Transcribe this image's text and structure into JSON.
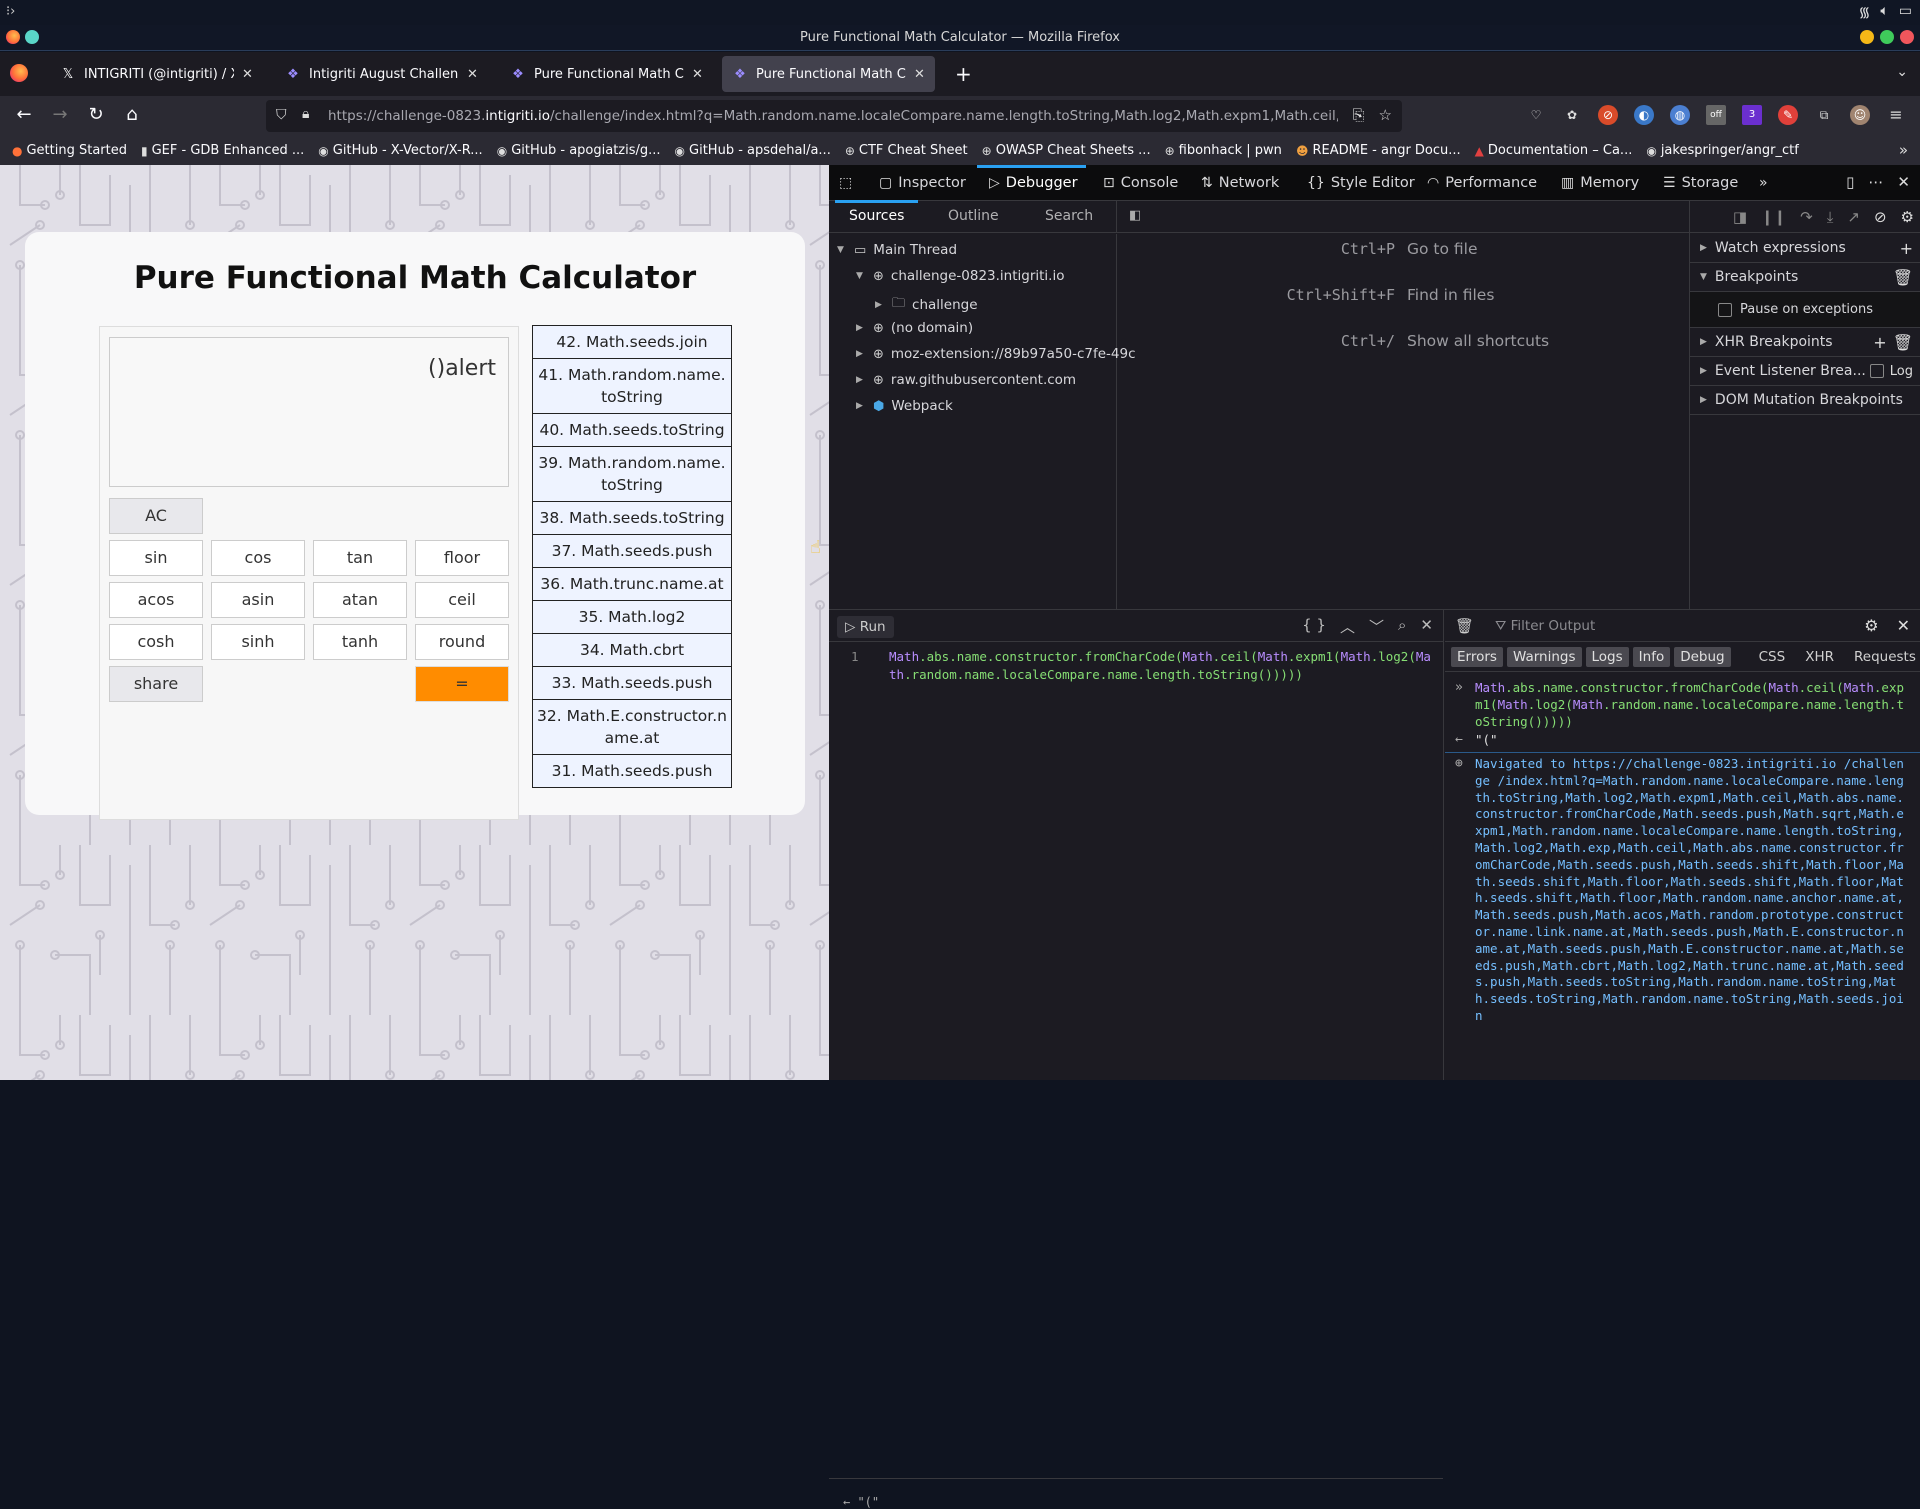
{
  "system": {
    "launcher_icon": "launcher-icon",
    "tray": [
      "wifi-icon",
      "volume-icon",
      "battery-icon"
    ]
  },
  "window": {
    "title": "Pure Functional Math Calculator — Mozilla Firefox"
  },
  "tabs": [
    {
      "label": "INTIGRITI (@intigriti) / X",
      "icon": "x-logo-icon",
      "glyph": "𝕏"
    },
    {
      "label": "Intigriti August Challenge",
      "icon": "intigriti-icon",
      "glyph": "❖"
    },
    {
      "label": "Pure Functional Math Calculator",
      "icon": "intigriti-icon",
      "glyph": "❖"
    },
    {
      "label": "Pure Functional Math Calculator",
      "icon": "intigriti-icon",
      "glyph": "❖",
      "active": true
    }
  ],
  "nav": {
    "url_prefix": "https://challenge-0823.",
    "url_domain": "intigriti.io",
    "url_rest": "/challenge/index.html?q=Math.random.name.localeCompare.name.length.toString,Math.log2,Math.expm1,Math.ceil,Math.abs.name.constructor.fromCharCode",
    "extension_badges": {
      "off": "off",
      "count": "3"
    }
  },
  "bookmarks": [
    {
      "label": "Getting Started",
      "glyph": "●"
    },
    {
      "label": "GEF - GDB Enhanced ...",
      "glyph": "▮"
    },
    {
      "label": "GitHub - X-Vector/X-R...",
      "glyph": "◉"
    },
    {
      "label": "GitHub - apogiatzis/g...",
      "glyph": "◉"
    },
    {
      "label": "GitHub - apsdehal/a...",
      "glyph": "◉"
    },
    {
      "label": "CTF Cheat Sheet",
      "glyph": "⊕"
    },
    {
      "label": "OWASP Cheat Sheets ...",
      "glyph": "⊕"
    },
    {
      "label": "fibonhack | pwn",
      "glyph": "⊕"
    },
    {
      "label": "README - angr Docu...",
      "glyph": "☻"
    },
    {
      "label": "Documentation – Ca...",
      "glyph": "▲"
    },
    {
      "label": "jakespringer/angr_ctf",
      "glyph": "◉"
    }
  ],
  "calculator": {
    "title": "Pure Functional Math Calculator",
    "display": "()alert",
    "buttons": {
      "ac": "AC",
      "row1": [
        "sin",
        "cos",
        "tan",
        "floor"
      ],
      "row2": [
        "acos",
        "asin",
        "atan",
        "ceil"
      ],
      "row3": [
        "cosh",
        "sinh",
        "tanh",
        "round"
      ],
      "share": "share",
      "equals": "="
    },
    "history": [
      "42. Math.seeds.join",
      "41. Math.random.name.toString",
      "40. Math.seeds.toString",
      "39. Math.random.name.toString",
      "38. Math.seeds.toString",
      "37. Math.seeds.push",
      "36. Math.trunc.name.at",
      "35. Math.log2",
      "34. Math.cbrt",
      "33. Math.seeds.push",
      "32. Math.E.constructor.name.at",
      "31. Math.seeds.push"
    ]
  },
  "devtools": {
    "tabs": [
      "Inspector",
      "Debugger",
      "Console",
      "Network",
      "Style Editor",
      "Performance",
      "Memory",
      "Storage"
    ],
    "active_tab": "Debugger",
    "source_tabs": [
      "Sources",
      "Outline",
      "Search"
    ],
    "tree": {
      "main_thread": "Main Thread",
      "domain": "challenge-0823.intigriti.io",
      "folder": "challenge",
      "no_domain": "(no domain)",
      "extension": "moz-extension://89b97a50-c7fe-49c",
      "raw": "raw.githubusercontent.com",
      "webpack": "Webpack"
    },
    "shortcuts": [
      {
        "keys": "Ctrl+P",
        "label": "Go to file"
      },
      {
        "keys": "Ctrl+Shift+F",
        "label": "Find in files"
      },
      {
        "keys": "Ctrl+/",
        "label": "Show all shortcuts"
      }
    ],
    "breakpoints": {
      "watch": "Watch expressions",
      "breakpoints": "Breakpoints",
      "pause_exceptions": "Pause on exceptions",
      "xhr": "XHR Breakpoints",
      "event": "Event Listener Brea...",
      "log": "Log",
      "dom": "DOM Mutation Breakpoints"
    },
    "console": {
      "run_label": "Run",
      "line_number": "1",
      "editor_code_parts": [
        {
          "t": "Math",
          "k": 1
        },
        {
          "t": ".abs.name.constructor.fromCharCode(",
          "k": 0
        },
        {
          "t": "Math",
          "k": 1
        },
        {
          "t": ".ceil(",
          "k": 0
        },
        {
          "t": "Math",
          "k": 1
        },
        {
          "t": ".expm1(",
          "k": 0
        },
        {
          "t": "Math",
          "k": 1
        },
        {
          "t": ".log2(",
          "k": 0
        },
        {
          "t": "Math",
          "k": 1
        },
        {
          "t": ".random.name.localeCompare.name.length.toString()))))",
          "k": 0
        }
      ],
      "filter_placeholder": "Filter Output",
      "levels": [
        "Errors",
        "Warnings",
        "Logs",
        "Info",
        "Debug"
      ],
      "extra_filters": [
        "CSS",
        "XHR",
        "Requests"
      ],
      "input_echo": "Math.abs.name.constructor.fromCharCode(Math.ceil(Math.expm1(Math.log2(Math.random.name.localeCompare.name.length.toString()))))",
      "result": "\"(\"",
      "navigated": "Navigated to https://challenge-0823.intigriti.io /challenge /index.html?q=Math.random.name.localeCompare.name.length.toString,Math.log2,Math.expm1,Math.ceil,Math.abs.name.constructor.fromCharCode,Math.seeds.push,Math.sqrt,Math.expm1,Math.random.name.localeCompare.name.length.toString,Math.log2,Math.exp,Math.ceil,Math.abs.name.constructor.fromCharCode,Math.seeds.push,Math.seeds.shift,Math.floor,Math.seeds.shift,Math.floor,Math.seeds.shift,Math.floor,Math.seeds.shift,Math.floor,Math.random.name.anchor.name.at,Math.seeds.push,Math.acos,Math.random.prototype.constructor.name.link.name.at,Math.seeds.push,Math.E.constructor.name.at,Math.seeds.push,Math.E.constructor.name.at,Math.seeds.push,Math.cbrt,Math.log2,Math.trunc.name.at,Math.seeds.push,Math.seeds.toString,Math.random.name.toString,Math.seeds.toString,Math.random.name.toString,Math.seeds.join",
      "eval_preview": "\"(\""
    }
  }
}
